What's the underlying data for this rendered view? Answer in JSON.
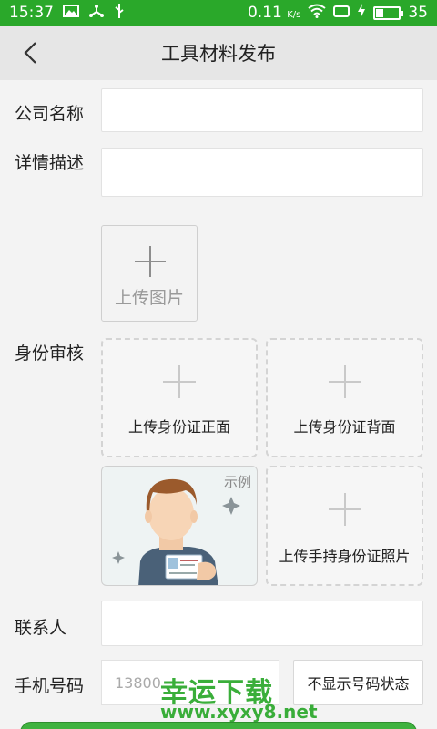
{
  "status_bar": {
    "time": "15:37",
    "network_speed": "0.11",
    "network_unit": "K/s",
    "battery_level": "35",
    "battery_fraction": 0.35,
    "icons": [
      "image-icon",
      "usb-share-icon",
      "usb-icon",
      "wifi-icon",
      "sim-icon",
      "charging-icon",
      "battery-icon"
    ]
  },
  "header": {
    "title": "工具材料发布",
    "back_icon": "chevron-left-icon"
  },
  "form": {
    "company_label": "公司名称",
    "company_value": "",
    "detail_label": "详情描述",
    "detail_value": "",
    "upload_image_label": "上传图片",
    "identity_label": "身份审核",
    "id_front_label": "上传身份证正面",
    "id_back_label": "上传身份证背面",
    "example_tag": "示例",
    "id_handheld_label": "上传手持身份证照片",
    "contact_label": "联系人",
    "contact_value": "",
    "phone_label": "手机号码",
    "phone_placeholder": "13800",
    "hide_phone_button": "不显示号码状态"
  },
  "watermark": {
    "text": "幸运下载",
    "url": "www.xyxy8.net"
  },
  "colors": {
    "accent": "#2aa82a",
    "background": "#f3f3f3",
    "header_bg": "#e6e6e6"
  }
}
